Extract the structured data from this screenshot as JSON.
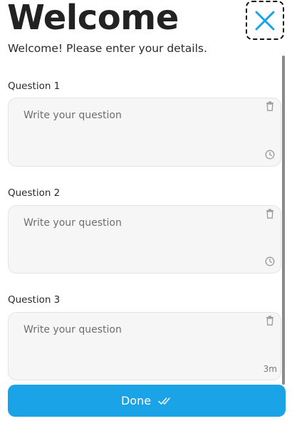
{
  "header": {
    "title": "Welcome",
    "subtitle": "Welcome! Please enter your details."
  },
  "close_button": {
    "icon": "close-icon"
  },
  "questions": [
    {
      "label": "Question 1",
      "placeholder": "Write your question",
      "footer": "clock-icon"
    },
    {
      "label": "Question 2",
      "placeholder": "Write your question",
      "footer": "clock-icon"
    },
    {
      "label": "Question 3",
      "placeholder": "Write your question",
      "timer": "3m"
    }
  ],
  "done_button": {
    "label": "Done",
    "icon": "double-check-icon"
  },
  "colors": {
    "accent": "#1ba3e8",
    "close_icon": "#1ba3e8",
    "field_bg": "#f5f6f5",
    "field_border": "#e3e5e3"
  }
}
